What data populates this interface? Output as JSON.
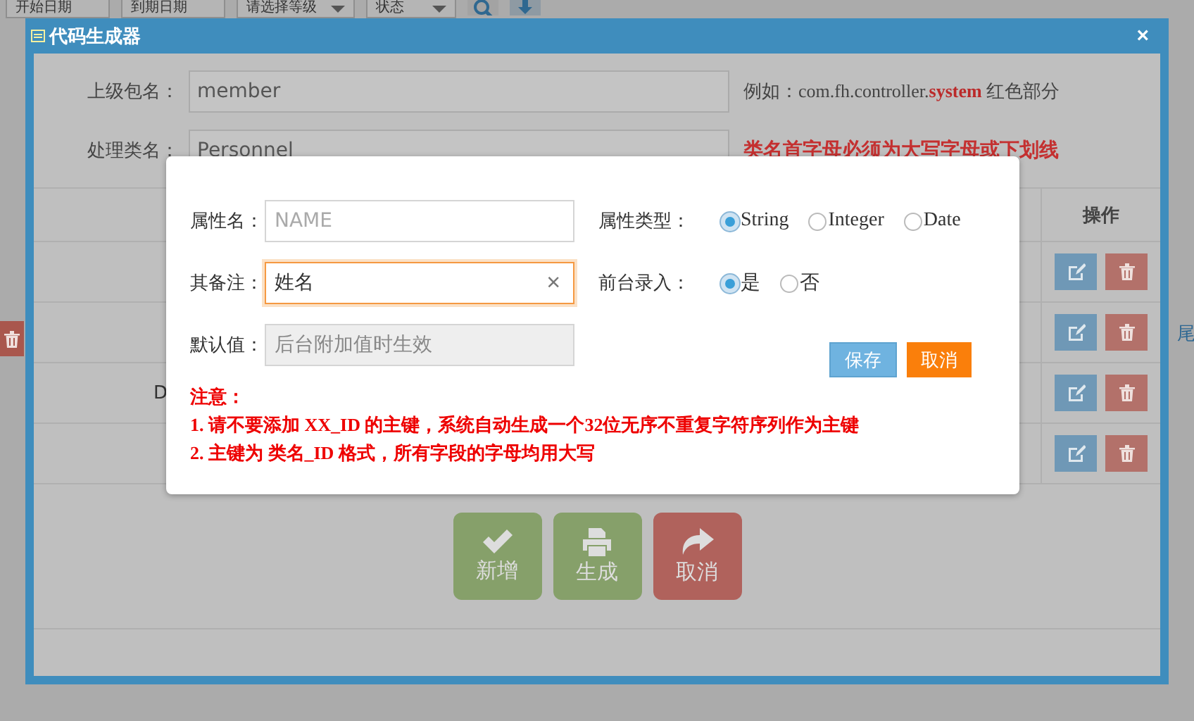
{
  "page": {
    "filters": [
      {
        "kind": "input",
        "placeholder": "开始日期"
      },
      {
        "kind": "input",
        "placeholder": "到期日期"
      },
      {
        "kind": "select",
        "value": "请选择等级"
      },
      {
        "kind": "select",
        "value": "状态"
      }
    ],
    "side_link": "尾"
  },
  "dialog": {
    "title": "代码生成器",
    "close": "×",
    "form": [
      {
        "label": "上级包名：",
        "value": "member",
        "kind": "example",
        "hint": "例如：com.fh.controller.**system** 红色部分"
      },
      {
        "label": "处理类名：",
        "value": "Personnel",
        "kind": "warning",
        "hint": "类名首字母必须为大写字母或下划线"
      }
    ],
    "table": {
      "action_column": "操作",
      "rows": [
        {
          "kind": "blank"
        },
        {
          "kind": "blank"
        },
        {
          "kind": "text",
          "column_1": "D"
        },
        {
          "kind": "blank"
        }
      ]
    },
    "buttons": [
      {
        "label": "新增",
        "kind": "add"
      },
      {
        "label": "生成",
        "kind": "generate"
      },
      {
        "label": "取消",
        "kind": "cancel"
      }
    ]
  },
  "modal": {
    "rows": [
      {
        "field": {
          "label": "属性名：",
          "placeholder": "NAME",
          "focused": false,
          "disabled": false
        },
        "option": {
          "label": "属性类型：",
          "choices": [
            {
              "label": "String",
              "selected": true
            },
            {
              "label": "Integer",
              "selected": false
            },
            {
              "label": "Date",
              "selected": false
            }
          ]
        }
      },
      {
        "field": {
          "label": "其备注：",
          "value": "姓名",
          "clear": "×",
          "focused": true,
          "disabled": false
        },
        "option": {
          "label": "前台录入：",
          "choices": [
            {
              "label": "是",
              "selected": true
            },
            {
              "label": "否",
              "selected": false
            }
          ]
        }
      },
      {
        "field": {
          "label": "默认值：",
          "placeholder": "后台附加值时生效",
          "focused": false,
          "disabled": true
        },
        "buttons": [
          {
            "label": "保存",
            "kind": "primary"
          },
          {
            "label": "取消",
            "kind": "warning"
          }
        ]
      }
    ],
    "notes": [
      "注意：",
      "1. 请不要添加 XX_ID 的主键，系统自动生成一个32位无序不重复字符序列作为主键",
      "2. 主键为 类名_ID 格式，所有字段的字母均用大写"
    ]
  }
}
